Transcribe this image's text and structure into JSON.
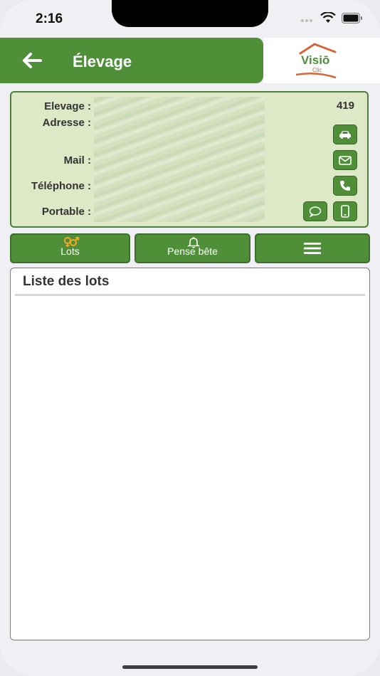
{
  "status_bar": {
    "time": "2:16"
  },
  "header": {
    "title": "Élevage",
    "logo_text": "Visiō",
    "logo_sub": "Clic"
  },
  "info": {
    "elevage_label": "Elevage :",
    "elevage_value": "419",
    "adresse_label": "Adresse :",
    "mail_label": "Mail :",
    "telephone_label": "Téléphone :",
    "portable_label": "Portable :"
  },
  "tabs": {
    "lots_label": "Lots",
    "pense_label": "Pense bête"
  },
  "list": {
    "title": "Liste des lots"
  },
  "colors": {
    "primary": "#4e8f38",
    "card_bg": "#dce8c6",
    "accent": "#f5a623"
  }
}
